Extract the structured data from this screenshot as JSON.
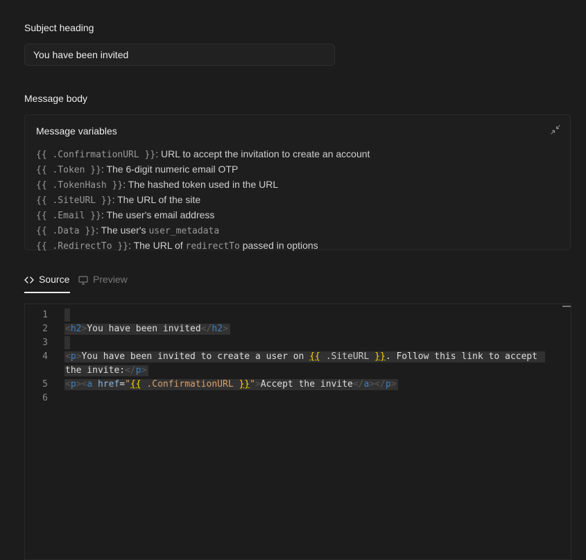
{
  "subject": {
    "label": "Subject heading",
    "value": "You have been invited"
  },
  "body": {
    "label": "Message body"
  },
  "variables": {
    "title": "Message variables",
    "collapse_icon": "collapse-icon",
    "items": [
      {
        "code": "{{ .ConfirmationURL }}",
        "desc": ": URL to accept the invitation to create an account"
      },
      {
        "code": "{{ .Token }}",
        "desc": ": The 6-digit numeric email OTP"
      },
      {
        "code": "{{ .TokenHash }}",
        "desc": ": The hashed token used in the URL"
      },
      {
        "code": "{{ .SiteURL }}",
        "desc": ": The URL of the site"
      },
      {
        "code": "{{ .Email }}",
        "desc": ": The user's email address"
      },
      {
        "code": "{{ .Data }}",
        "desc": ": The user's ",
        "code2": "user_metadata",
        "desc2": ""
      },
      {
        "code": "{{ .RedirectTo }}",
        "desc": ": The URL of ",
        "code2": "redirectTo",
        "desc2": " passed in options"
      }
    ]
  },
  "tabs": {
    "source": "Source",
    "preview": "Preview",
    "active": "source",
    "source_icon": "code-icon",
    "preview_icon": "monitor-icon"
  },
  "editor": {
    "line_numbers": [
      "1",
      "2",
      "3",
      "4",
      "5",
      "6"
    ],
    "content": [
      "",
      "<h2>You have been invited</h2>",
      "",
      "<p>You have been invited to create a user on {{ .SiteURL }}. Follow this link to accept the invite:</p>",
      "<p><a href=\"{{ .ConfirmationURL }}\">Accept the invite</a></p>",
      ""
    ]
  }
}
